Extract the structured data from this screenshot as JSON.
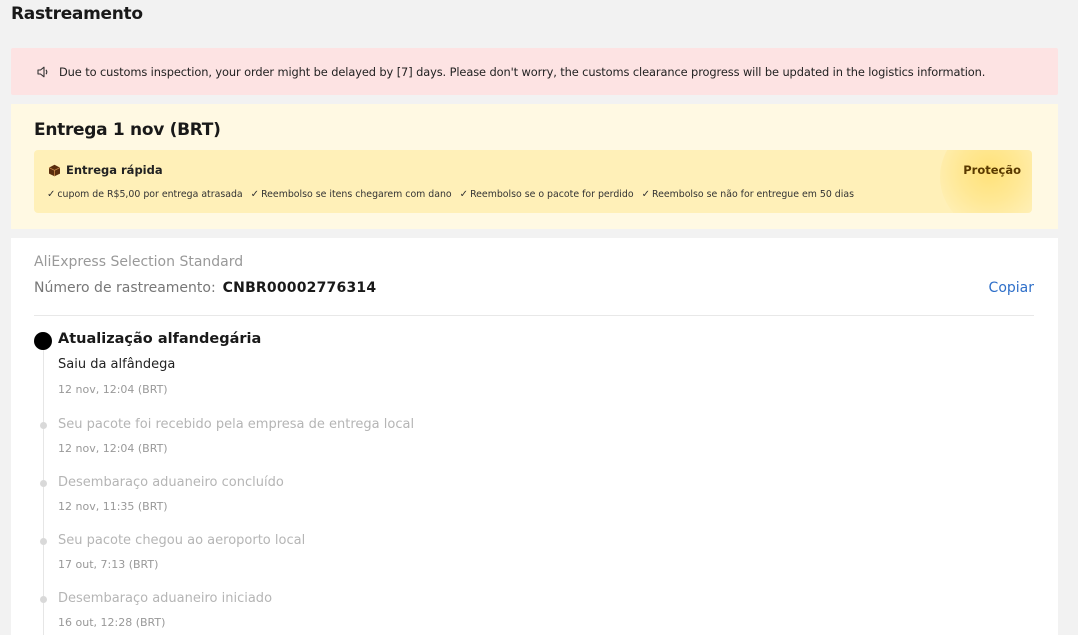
{
  "page": {
    "title": "Rastreamento"
  },
  "notice": {
    "icon": "speaker-icon",
    "text": "Due to customs inspection, your order might be delayed by [7] days. Please don't worry, the customs clearance progress will be updated in the logistics information."
  },
  "delivery": {
    "title": "Entrega 1 nov (BRT)",
    "fast_label": "Entrega rápida",
    "fast_icon": "package-icon",
    "protection_label": "Proteção",
    "benefits": [
      "cupom de R$5,00 por entrega atrasada",
      "Reembolso se itens chegarem com dano",
      "Reembolso se o pacote for perdido",
      "Reembolso se não for entregue em 50 dias"
    ],
    "colors": {
      "background": "#fff9e3",
      "box": "#fff0b8"
    }
  },
  "tracking": {
    "carrier": "AliExpress Selection Standard",
    "number_label": "Número de rastreamento:",
    "number": "CNBR00002776314",
    "copy_label": "Copiar",
    "colors": {
      "link": "#2e6fc9"
    }
  },
  "timeline": [
    {
      "title": "Atualização alfandegária",
      "subtitle": "Saiu da alfândega",
      "time": "12 nov, 12:04 (BRT)",
      "current": true
    },
    {
      "title": "Seu pacote foi recebido pela empresa de entrega local",
      "time": "12 nov, 12:04 (BRT)",
      "current": false
    },
    {
      "title": "Desembaraço aduaneiro concluído",
      "time": "12 nov, 11:35 (BRT)",
      "current": false
    },
    {
      "title": "Seu pacote chegou ao aeroporto local",
      "time": "17 out, 7:13 (BRT)",
      "current": false
    },
    {
      "title": "Desembaraço aduaneiro iniciado",
      "time": "16 out, 12:28 (BRT)",
      "current": false
    }
  ]
}
